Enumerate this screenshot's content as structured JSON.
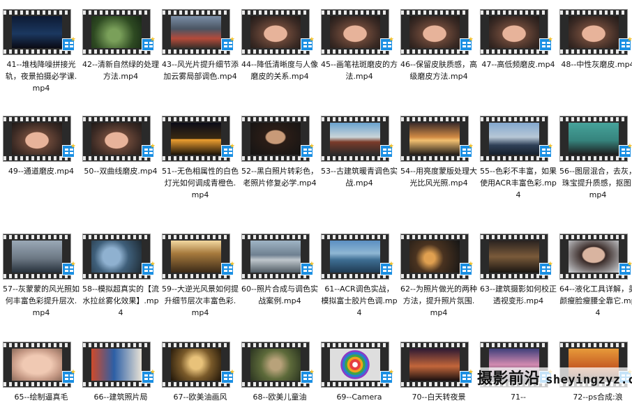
{
  "colors": {
    "badge": "#1a8fe3",
    "background": "#ffffff",
    "text": "#111111"
  },
  "files": [
    {
      "label": "41--堆栈降噪拼接光轨，夜景拍摄必学课.mp4",
      "theme": "city",
      "icon": "video-file-icon"
    },
    {
      "label": "42--清新自然绿的处理方法.mp4",
      "theme": "green",
      "icon": "video-file-icon"
    },
    {
      "label": "43--风光片提升细节添加云雾局部调色.mp4",
      "theme": "mountain",
      "icon": "video-file-icon"
    },
    {
      "label": "44--降低清晰度与人像磨皮的关系.mp4",
      "theme": "face",
      "icon": "video-file-icon"
    },
    {
      "label": "45--画笔祛斑磨皮的方法.mp4",
      "theme": "face",
      "icon": "video-file-icon"
    },
    {
      "label": "46--保留皮肤质感，高级磨皮方法.mp4",
      "theme": "face",
      "icon": "video-file-icon"
    },
    {
      "label": "47--高低频磨皮.mp4",
      "theme": "face",
      "icon": "video-file-icon"
    },
    {
      "label": "48--中性灰磨皮.mp4",
      "theme": "face",
      "icon": "video-file-icon"
    },
    {
      "label": "49--通道磨皮.mp4",
      "theme": "face",
      "icon": "video-file-icon"
    },
    {
      "label": "50--双曲线磨皮.mp4",
      "theme": "face",
      "icon": "video-file-icon"
    },
    {
      "label": "51--无色相属性的白色灯光如何调成青橙色.mp4",
      "theme": "night",
      "icon": "video-file-icon"
    },
    {
      "label": "52--黑白照片转彩色，老照片修复必学.mp4",
      "theme": "portraitdark",
      "icon": "video-file-icon"
    },
    {
      "label": "53--古建筑暖青调色实战.mp4",
      "theme": "temple",
      "icon": "video-file-icon"
    },
    {
      "label": "54--用亮度蒙版处理大光比风光照.mp4",
      "theme": "sunset",
      "icon": "video-file-icon"
    },
    {
      "label": "55--色彩不丰富，如果使用ACR丰富色彩.mp4",
      "theme": "coast",
      "icon": "video-file-icon"
    },
    {
      "label": "56--图层混合，去灰，珠宝提升质感，抠图.mp4",
      "theme": "jewel",
      "icon": "video-file-icon"
    },
    {
      "label": "57--灰蒙蒙的风光照如何丰富色彩提升层次.mp4",
      "theme": "fog",
      "icon": "video-file-icon"
    },
    {
      "label": "58--模拟超真实的【流水拉丝雾化效果】.mp4",
      "theme": "water",
      "icon": "video-file-icon"
    },
    {
      "label": "59--大逆光风景如何提升细节层次丰富色彩.mp4",
      "theme": "backlight",
      "icon": "video-file-icon"
    },
    {
      "label": "60--照片合成与调色实战案例.mp4",
      "theme": "lake",
      "icon": "video-file-icon"
    },
    {
      "label": "61--ACR调色实战，模拟富士胶片色调.mp4",
      "theme": "castle",
      "icon": "video-file-icon"
    },
    {
      "label": "62--为照片做光的两种方法，提升照片氛围.mp4",
      "theme": "lamp",
      "icon": "video-file-icon"
    },
    {
      "label": "63--建筑摄影如何校正透视变形.mp4",
      "theme": "building",
      "icon": "video-file-icon"
    },
    {
      "label": "64--液化工具详解，美颜瘦脸瘦腰全靠它.mp4",
      "theme": "woman",
      "icon": "video-file-icon"
    },
    {
      "label": "65--绘制逼真毛",
      "theme": "eye",
      "icon": "video-file-icon"
    },
    {
      "label": "66--建筑照片局",
      "theme": "street",
      "icon": "video-file-icon"
    },
    {
      "label": "67--欧美油画风",
      "theme": "oil",
      "icon": "video-file-icon"
    },
    {
      "label": "68--欧美儿童油",
      "theme": "child",
      "icon": "video-file-icon"
    },
    {
      "label": "69--Camera",
      "theme": "wheel",
      "icon": "video-file-icon"
    },
    {
      "label": "70--白天转夜景",
      "theme": "dusk",
      "icon": "video-file-icon"
    },
    {
      "label": "71--",
      "theme": "twilight",
      "icon": "video-file-icon"
    },
    {
      "label": "72--ps合成:浪",
      "theme": "orange",
      "icon": "video-file-icon"
    }
  ],
  "watermark": {
    "cn": "摄影前沿",
    "en": "sheyingzyz.com"
  }
}
